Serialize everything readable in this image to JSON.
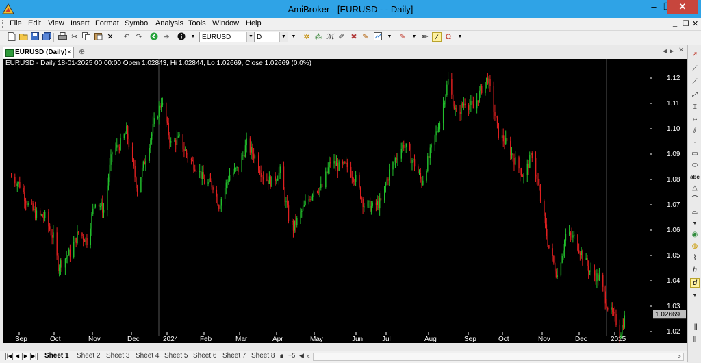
{
  "window": {
    "title": "AmiBroker - [EURUSD -  - Daily]",
    "controls": {
      "minimize": "–",
      "restore": "❐",
      "close": "✕"
    }
  },
  "menu": {
    "items": [
      "File",
      "Edit",
      "View",
      "Insert",
      "Format",
      "Symbol",
      "Analysis",
      "Tools",
      "Window",
      "Help"
    ],
    "mdi_controls": [
      "_",
      "❐",
      "✕"
    ]
  },
  "toolbar": {
    "symbol_value": "EURUSD",
    "interval_value": "D",
    "icons": [
      "new-icon",
      "open-icon",
      "save-icon",
      "save-all-icon",
      "print-icon",
      "cut-icon",
      "copy-icon",
      "paste-icon",
      "delete-icon",
      "undo-icon",
      "redo-icon",
      "back-icon",
      "forward-icon",
      "info-icon",
      "bars-icon",
      "candles-icon",
      "line-icon",
      "indicator-icon",
      "tools-icon",
      "pointer-icon",
      "color-pen-icon",
      "pencil-icon",
      "highlighter-icon",
      "magnet-icon"
    ]
  },
  "tab": {
    "label": "EURUSD (Daily)",
    "close": "×",
    "new_tab": "⊕"
  },
  "chart": {
    "legend": "EURUSD - Daily 18-01-2025 00:00:00 Open 1.02843, Hi 1.02844, Lo 1.02669, Close 1.02669 (0.0%)",
    "price_tag": "1.02669",
    "colors": {
      "up": "#22c02c",
      "down": "#e02020",
      "bg": "#000000",
      "axis_text": "#ffffff",
      "tag_bg": "#bdbdbd"
    }
  },
  "chart_data": {
    "type": "candlestick",
    "symbol": "EURUSD",
    "interval": "Daily",
    "y_ticks": [
      "1.12",
      "1.11",
      "1.10",
      "1.09",
      "1.08",
      "1.07",
      "1.06",
      "1.05",
      "1.04",
      "1.03",
      "1.02"
    ],
    "x_ticks": [
      "Sep",
      "Oct",
      "Nov",
      "Dec",
      "2024",
      "Feb",
      "Mar",
      "Apr",
      "May",
      "Jun",
      "Jul",
      "Aug",
      "Sep",
      "Oct",
      "Nov",
      "Dec",
      "2025"
    ],
    "ylim": [
      1.0135,
      1.1225
    ],
    "last_close": 1.02669,
    "close_path": [
      {
        "date": "2023-08-25",
        "close": 1.081
      },
      {
        "date": "2023-09-01",
        "close": 1.078
      },
      {
        "date": "2023-09-08",
        "close": 1.07
      },
      {
        "date": "2023-09-15",
        "close": 1.066
      },
      {
        "date": "2023-09-22",
        "close": 1.065
      },
      {
        "date": "2023-09-29",
        "close": 1.057
      },
      {
        "date": "2023-10-03",
        "close": 1.046
      },
      {
        "date": "2023-10-13",
        "close": 1.051
      },
      {
        "date": "2023-10-20",
        "close": 1.059
      },
      {
        "date": "2023-10-27",
        "close": 1.056
      },
      {
        "date": "2023-11-03",
        "close": 1.072
      },
      {
        "date": "2023-11-10",
        "close": 1.068
      },
      {
        "date": "2023-11-17",
        "close": 1.091
      },
      {
        "date": "2023-11-24",
        "close": 1.094
      },
      {
        "date": "2023-11-29",
        "close": 1.099
      },
      {
        "date": "2023-12-08",
        "close": 1.076
      },
      {
        "date": "2023-12-15",
        "close": 1.089
      },
      {
        "date": "2023-12-22",
        "close": 1.102
      },
      {
        "date": "2023-12-28",
        "close": 1.111
      },
      {
        "date": "2024-01-05",
        "close": 1.094
      },
      {
        "date": "2024-01-12",
        "close": 1.096
      },
      {
        "date": "2024-01-19",
        "close": 1.089
      },
      {
        "date": "2024-01-26",
        "close": 1.085
      },
      {
        "date": "2024-02-02",
        "close": 1.079
      },
      {
        "date": "2024-02-09",
        "close": 1.078
      },
      {
        "date": "2024-02-14",
        "close": 1.07
      },
      {
        "date": "2024-02-23",
        "close": 1.082
      },
      {
        "date": "2024-03-01",
        "close": 1.084
      },
      {
        "date": "2024-03-08",
        "close": 1.094
      },
      {
        "date": "2024-03-15",
        "close": 1.089
      },
      {
        "date": "2024-03-22",
        "close": 1.081
      },
      {
        "date": "2024-03-29",
        "close": 1.079
      },
      {
        "date": "2024-04-05",
        "close": 1.083
      },
      {
        "date": "2024-04-12",
        "close": 1.065
      },
      {
        "date": "2024-04-16",
        "close": 1.061
      },
      {
        "date": "2024-04-26",
        "close": 1.07
      },
      {
        "date": "2024-05-03",
        "close": 1.076
      },
      {
        "date": "2024-05-10",
        "close": 1.077
      },
      {
        "date": "2024-05-17",
        "close": 1.087
      },
      {
        "date": "2024-05-24",
        "close": 1.085
      },
      {
        "date": "2024-05-31",
        "close": 1.085
      },
      {
        "date": "2024-06-07",
        "close": 1.08
      },
      {
        "date": "2024-06-14",
        "close": 1.07
      },
      {
        "date": "2024-06-21",
        "close": 1.069
      },
      {
        "date": "2024-06-28",
        "close": 1.071
      },
      {
        "date": "2024-07-05",
        "close": 1.083
      },
      {
        "date": "2024-07-12",
        "close": 1.09
      },
      {
        "date": "2024-07-17",
        "close": 1.094
      },
      {
        "date": "2024-07-26",
        "close": 1.086
      },
      {
        "date": "2024-08-01",
        "close": 1.079
      },
      {
        "date": "2024-08-09",
        "close": 1.092
      },
      {
        "date": "2024-08-16",
        "close": 1.103
      },
      {
        "date": "2024-08-23",
        "close": 1.119
      },
      {
        "date": "2024-08-30",
        "close": 1.105
      },
      {
        "date": "2024-09-06",
        "close": 1.111
      },
      {
        "date": "2024-09-13",
        "close": 1.108
      },
      {
        "date": "2024-09-20",
        "close": 1.116
      },
      {
        "date": "2024-09-25",
        "close": 1.12
      },
      {
        "date": "2024-10-04",
        "close": 1.098
      },
      {
        "date": "2024-10-11",
        "close": 1.094
      },
      {
        "date": "2024-10-18",
        "close": 1.087
      },
      {
        "date": "2024-10-25",
        "close": 1.081
      },
      {
        "date": "2024-11-01",
        "close": 1.09
      },
      {
        "date": "2024-11-08",
        "close": 1.072
      },
      {
        "date": "2024-11-15",
        "close": 1.053
      },
      {
        "date": "2024-11-22",
        "close": 1.042
      },
      {
        "date": "2024-11-29",
        "close": 1.058
      },
      {
        "date": "2024-12-06",
        "close": 1.057
      },
      {
        "date": "2024-12-13",
        "close": 1.05
      },
      {
        "date": "2024-12-20",
        "close": 1.043
      },
      {
        "date": "2024-12-27",
        "close": 1.041
      },
      {
        "date": "2025-01-03",
        "close": 1.03
      },
      {
        "date": "2025-01-10",
        "close": 1.024
      },
      {
        "date": "2025-01-13",
        "close": 1.019
      },
      {
        "date": "2025-01-18",
        "close": 1.02669
      }
    ]
  },
  "right_toolbar": {
    "icons": [
      "arrow-pointer-icon",
      "trend-line-icon",
      "ray-icon",
      "extended-line-icon",
      "vertical-line-icon",
      "horizontal-line-icon",
      "parallel-lines-icon",
      "fan-icon",
      "rectangle-icon",
      "ellipse-icon",
      "text-icon",
      "triangle-icon",
      "arc-icon",
      "cycle-icon",
      "fibonacci-icon",
      "pitchfork-icon",
      "gann-icon",
      "study-icon",
      "bars-icon",
      "periodic-lines-icon"
    ],
    "text_label": "abc",
    "cycle_label": "d"
  },
  "sheets": {
    "tabs": [
      "Sheet 1",
      "Sheet 2",
      "Sheet 3",
      "Sheet 4",
      "Sheet 5",
      "Sheet 6",
      "Sheet 7",
      "Sheet 8"
    ],
    "active": "Sheet 1",
    "extra": "+5"
  }
}
